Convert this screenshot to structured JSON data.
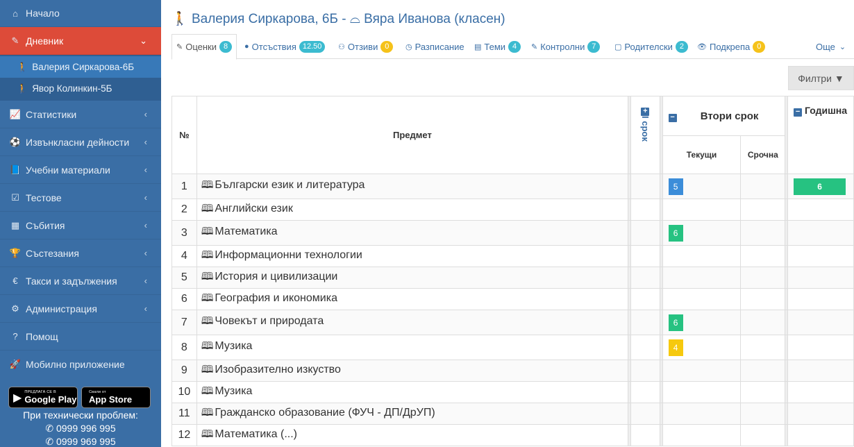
{
  "sidebar": {
    "items": [
      {
        "label": "Начало",
        "icon": "home-icon",
        "glyph": "⌂"
      },
      {
        "label": "Дневник",
        "icon": "edit-icon",
        "glyph": "✎",
        "active": true
      },
      {
        "label": "Статистики",
        "icon": "chart-icon",
        "glyph": "📈"
      },
      {
        "label": "Извънкласни дейности",
        "icon": "ball-icon",
        "glyph": "⚽"
      },
      {
        "label": "Учебни материали",
        "icon": "book-icon",
        "glyph": "📘"
      },
      {
        "label": "Тестове",
        "icon": "checkbox-icon",
        "glyph": "☑"
      },
      {
        "label": "Събития",
        "icon": "calendar-icon",
        "glyph": "▦"
      },
      {
        "label": "Състезания",
        "icon": "trophy-icon",
        "glyph": "🏆"
      },
      {
        "label": "Такси и задължения",
        "icon": "euro-icon",
        "glyph": "€"
      },
      {
        "label": "Администрация",
        "icon": "cogs-icon",
        "glyph": "⚙"
      },
      {
        "label": "Помощ",
        "icon": "question-icon",
        "glyph": "?"
      },
      {
        "label": "Мобилно приложение",
        "icon": "rocket-icon",
        "glyph": "🚀"
      }
    ],
    "students": [
      "Валерия Сиркарова-6Б",
      "Явор Колинкин-5Б"
    ],
    "google_play": {
      "small": "ПРЕДЛАГА СЕ В",
      "big": "Google Play"
    },
    "app_store": {
      "small": "Свали от",
      "big": "App Store"
    },
    "tech_label": "При технически проблем:",
    "phones": [
      "0999 996 995",
      "0999 969 995"
    ]
  },
  "header": {
    "title_student": "Валерия Сиркарова, 6Б -",
    "title_teacher": "Вяра Иванова (класен)"
  },
  "tabs": [
    {
      "label": "Оценки",
      "badge": "8",
      "icon": "pencil-icon",
      "glyph": "✎"
    },
    {
      "label": "Отсъствия",
      "badge": "12.50",
      "icon": "info-icon",
      "glyph": "●"
    },
    {
      "label": "Отзиви",
      "badge": "0",
      "icon": "users-icon",
      "glyph": "⚇",
      "yellow": true
    },
    {
      "label": "Разписание",
      "badge": "",
      "icon": "clock-icon",
      "glyph": "◷"
    },
    {
      "label": "Теми",
      "badge": "4",
      "icon": "list-icon",
      "glyph": "▤"
    },
    {
      "label": "Контролни",
      "badge": "7",
      "icon": "edit-icon",
      "glyph": "✎"
    },
    {
      "label": "Родителски",
      "badge": "2",
      "icon": "calendar-icon",
      "glyph": "▢"
    },
    {
      "label": "Подкрепа",
      "badge": "0",
      "icon": "eye-icon",
      "glyph": "👁",
      "yellow": true
    },
    {
      "label": "Още",
      "badge": "",
      "icon": "chevron-down-icon",
      "glyph": "⌄"
    }
  ],
  "filters_label": "Филтри",
  "table": {
    "col_no": "№",
    "col_subject": "Предмет",
    "term1": "I срок",
    "term2": "Втори срок",
    "current": "Текущи",
    "term_grade": "Срочна",
    "yearly": "Годишна",
    "rows": [
      {
        "no": "1",
        "subject": "Български език и литература",
        "current": "5",
        "current_color": "#3c8dd9",
        "yearly": "6"
      },
      {
        "no": "2",
        "subject": "Английски език",
        "current": "",
        "yearly": ""
      },
      {
        "no": "3",
        "subject": "Математика",
        "current": "6",
        "current_color": "#26c281",
        "yearly": ""
      },
      {
        "no": "4",
        "subject": "Информационни технологии",
        "current": "",
        "yearly": ""
      },
      {
        "no": "5",
        "subject": "История и цивилизации",
        "current": "",
        "yearly": ""
      },
      {
        "no": "6",
        "subject": "География и икономика",
        "current": "",
        "yearly": ""
      },
      {
        "no": "7",
        "subject": "Човекът и природата",
        "current": "6",
        "current_color": "#26c281",
        "yearly": ""
      },
      {
        "no": "8",
        "subject": "Музика",
        "current": "4",
        "current_color": "#f6c90e",
        "yearly": ""
      },
      {
        "no": "9",
        "subject": "Изобразително изкуство",
        "current": "",
        "yearly": ""
      },
      {
        "no": "10",
        "subject": "Музика",
        "current": "",
        "yearly": ""
      },
      {
        "no": "11",
        "subject": "Гражданско образование (ФУЧ - ДП/ДрУП)",
        "current": "",
        "yearly": ""
      },
      {
        "no": "12",
        "subject": "Математика (...)",
        "current": "",
        "yearly": ""
      }
    ]
  },
  "colors": {
    "sidebar": "#3a6ea5",
    "active": "#dd4b39",
    "accent": "#3a6ea5",
    "badge": "#3cbbd0"
  }
}
